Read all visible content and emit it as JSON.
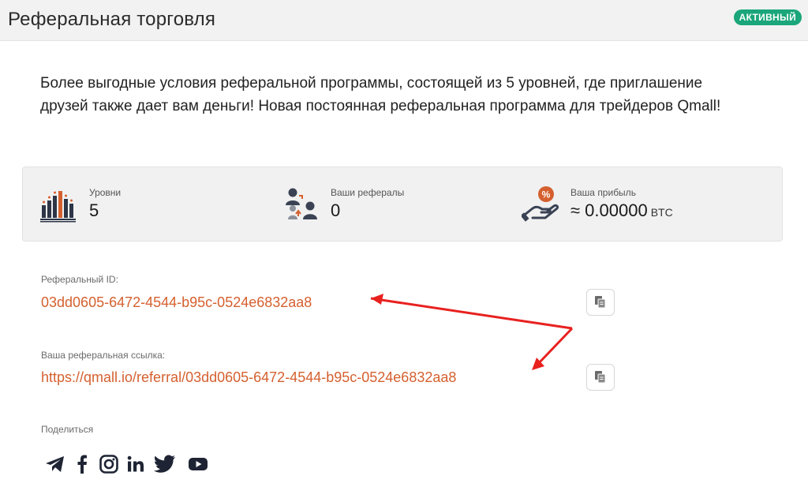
{
  "header": {
    "title": "Реферальная торговля",
    "status": "АКТИВНЫЙ"
  },
  "intro": "Более выгодные условия реферальной программы, состоящей из 5 уровней, где приглашение друзей также дает вам деньги! Новая постоянная реферальная программа для трейдеров Qmall!",
  "stats": {
    "levels": {
      "label": "Уровни",
      "value": "5",
      "icon": "bar-levels-icon"
    },
    "referrals": {
      "label": "Ваши рефералы",
      "value": "0",
      "icon": "referral-users-icon"
    },
    "profit": {
      "label": "Ваша прибыль",
      "value": "≈ 0.00000",
      "unit": "BTC",
      "icon": "hand-percent-icon"
    }
  },
  "referral_id": {
    "label": "Реферальный ID:",
    "value": "03dd0605-6472-4544-b95c-0524e6832aa8"
  },
  "referral_link": {
    "label": "Ваша реферальная ссылка:",
    "value": "https://qmall.io/referral/03dd0605-6472-4544-b95c-0524e6832aa8"
  },
  "share": {
    "label": "Поделиться",
    "networks": [
      "telegram-icon",
      "facebook-icon",
      "instagram-icon",
      "linkedin-icon",
      "twitter-icon",
      "youtube-icon"
    ]
  },
  "colors": {
    "accent": "#d5602f",
    "badge": "#1aa67a",
    "annotation_arrow": "#e8211f"
  }
}
